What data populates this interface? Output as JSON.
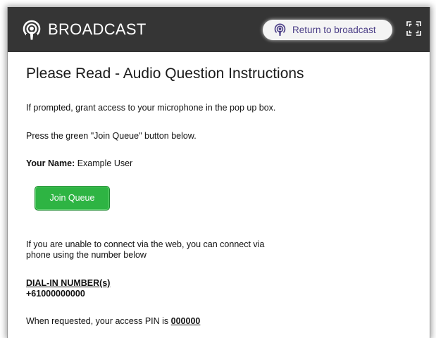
{
  "header": {
    "title": "BROADCAST",
    "return_label": "Return to broadcast",
    "brand_icon": "broadcast-podcast-icon",
    "return_icon": "broadcast-podcast-icon",
    "fullscreen_icon": "fullscreen-icon"
  },
  "main": {
    "heading": "Please Read - Audio Question Instructions",
    "line1": "If prompted, grant access to your microphone in the pop up box.",
    "line2": "Press the green \"Join Queue\" button below.",
    "name_label": "Your Name:",
    "name_value": " Example User",
    "join_label": "Join Queue",
    "phone_line1": "If you are unable to connect via the web, you can connect via",
    "phone_line2": "phone using the number below",
    "dial_label": "DIAL-IN NUMBER(s)",
    "dial_number": "+61000000000",
    "pin_prefix": "When requested, your access PIN is ",
    "pin_value": "000000"
  },
  "colors": {
    "header_bg": "#353535",
    "join_button": "#2eb443",
    "return_text": "#4a3d86"
  }
}
